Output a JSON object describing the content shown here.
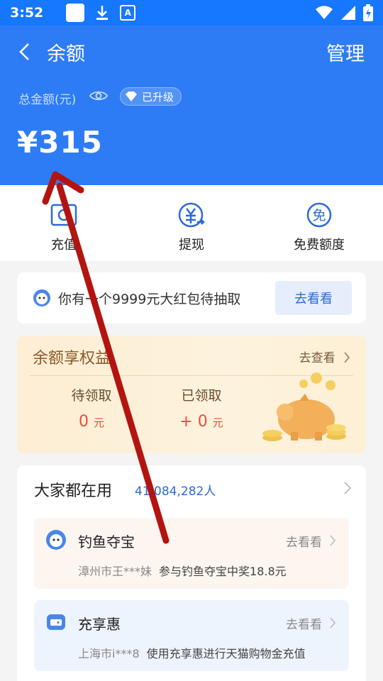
{
  "status_bar": {
    "time": "3:52"
  },
  "header": {
    "title": "余额",
    "manage": "管理",
    "total_label": "总金额(元)",
    "badge": "已升级",
    "balance": "¥315"
  },
  "actions": [
    {
      "label": "充值",
      "icon": "recharge-icon"
    },
    {
      "label": "提现",
      "icon": "withdraw-icon"
    },
    {
      "label": "免费额度",
      "icon": "free-quota-icon"
    }
  ],
  "banner": {
    "text": "你有一个9999元大红包待抽取",
    "button": "去看看"
  },
  "benefit": {
    "title": "余额享权益",
    "more": "去查看",
    "pending_label": "待领取",
    "pending_value": "0",
    "pending_unit": "元",
    "received_label": "已领取",
    "received_value": "+ 0",
    "received_unit": "元"
  },
  "popular": {
    "title": "大家都在用",
    "count": "41,084,282人",
    "items": [
      {
        "name": "钓鱼夺宝",
        "go": "去看看",
        "who": "漳州市王***妹",
        "desc": "参与钓鱼夺宝中奖18.8元"
      },
      {
        "name": "充享惠",
        "go": "去看看",
        "who": "上海市i***8",
        "desc": "使用充享惠进行天猫购物金充值"
      }
    ]
  },
  "colors": {
    "header_blue": "#2d7cf6",
    "accent_blue": "#2d6ad6",
    "value_red": "#e54e3c",
    "annotation_red": "#b3140f"
  }
}
